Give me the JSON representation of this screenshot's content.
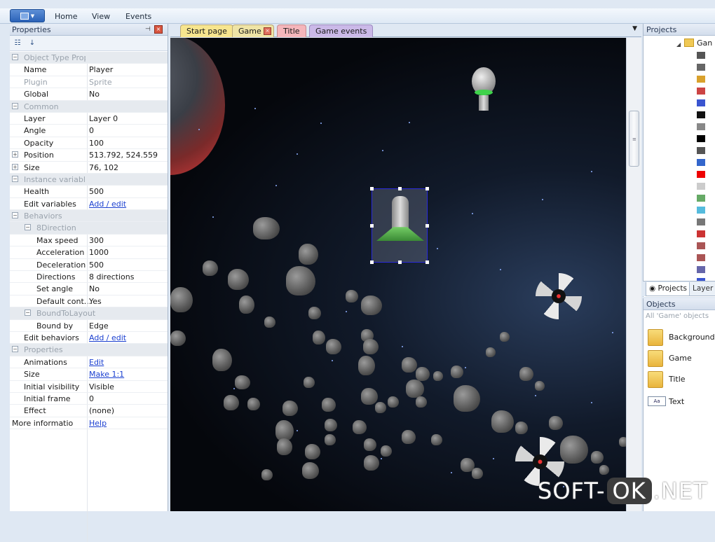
{
  "ribbon": {
    "tabs": [
      "Home",
      "View",
      "Events"
    ]
  },
  "properties": {
    "title": "Properties",
    "rows": [
      {
        "type": "cat",
        "label": "Object Type Properties"
      },
      {
        "label": "Name",
        "value": "Player"
      },
      {
        "label": "Plugin",
        "value": "Sprite",
        "disabled": true
      },
      {
        "label": "Global",
        "value": "No"
      },
      {
        "type": "cat",
        "label": "Common"
      },
      {
        "label": "Layer",
        "value": "Layer 0"
      },
      {
        "label": "Angle",
        "value": "0"
      },
      {
        "label": "Opacity",
        "value": "100"
      },
      {
        "label": "Position",
        "value": "513.792, 524.559",
        "expand": true
      },
      {
        "label": "Size",
        "value": "76, 102",
        "expand": true
      },
      {
        "type": "cat",
        "label": "Instance variables"
      },
      {
        "label": "Health",
        "value": "500"
      },
      {
        "label": "Edit variables",
        "value": "Add / edit",
        "link": true
      },
      {
        "type": "cat",
        "label": "Behaviors"
      },
      {
        "type": "subcat",
        "label": "8Direction"
      },
      {
        "label": "Max speed",
        "value": "300",
        "sub": true
      },
      {
        "label": "Acceleration",
        "value": "1000",
        "sub": true
      },
      {
        "label": "Deceleration",
        "value": "500",
        "sub": true
      },
      {
        "label": "Directions",
        "value": "8 directions",
        "sub": true
      },
      {
        "label": "Set angle",
        "value": "No",
        "sub": true
      },
      {
        "label": "Default cont...",
        "value": "Yes",
        "sub": true
      },
      {
        "type": "subcat",
        "label": "BoundToLayout"
      },
      {
        "label": "Bound by",
        "value": "Edge",
        "sub": true
      },
      {
        "label": "Edit behaviors",
        "value": "Add / edit",
        "link": true
      },
      {
        "type": "cat",
        "label": "Properties"
      },
      {
        "label": "Animations",
        "value": "Edit",
        "link": true
      },
      {
        "label": "Size",
        "value": "Make 1:1",
        "link": true
      },
      {
        "label": "Initial visibility",
        "value": "Visible"
      },
      {
        "label": "Initial frame",
        "value": "0"
      },
      {
        "label": "Effect",
        "value": "(none)"
      },
      {
        "label": "More information",
        "value": "Help",
        "link": true,
        "noindent": true
      }
    ]
  },
  "doc_tabs": {
    "start": "Start page",
    "game": "Game",
    "title": "Title",
    "events": "Game events"
  },
  "projects": {
    "title": "Projects",
    "tree_label": "Gan",
    "tab_projects": "Projects",
    "tab_layers": "Layer"
  },
  "objects": {
    "title": "Objects",
    "subtitle": "All 'Game' objects",
    "items": [
      "Backgrounds",
      "Game",
      "Title",
      "Text"
    ],
    "text_icon_label": "Aa"
  },
  "watermark": {
    "left": "SOFT-",
    "mid": "OK",
    "right": ".NET"
  },
  "colors": {
    "selection": "#2b2bd9",
    "link": "#1a3fd0",
    "tab_start": "#f7e58e",
    "tab_title": "#f5b6bb",
    "tab_events": "#cbb9e8"
  }
}
